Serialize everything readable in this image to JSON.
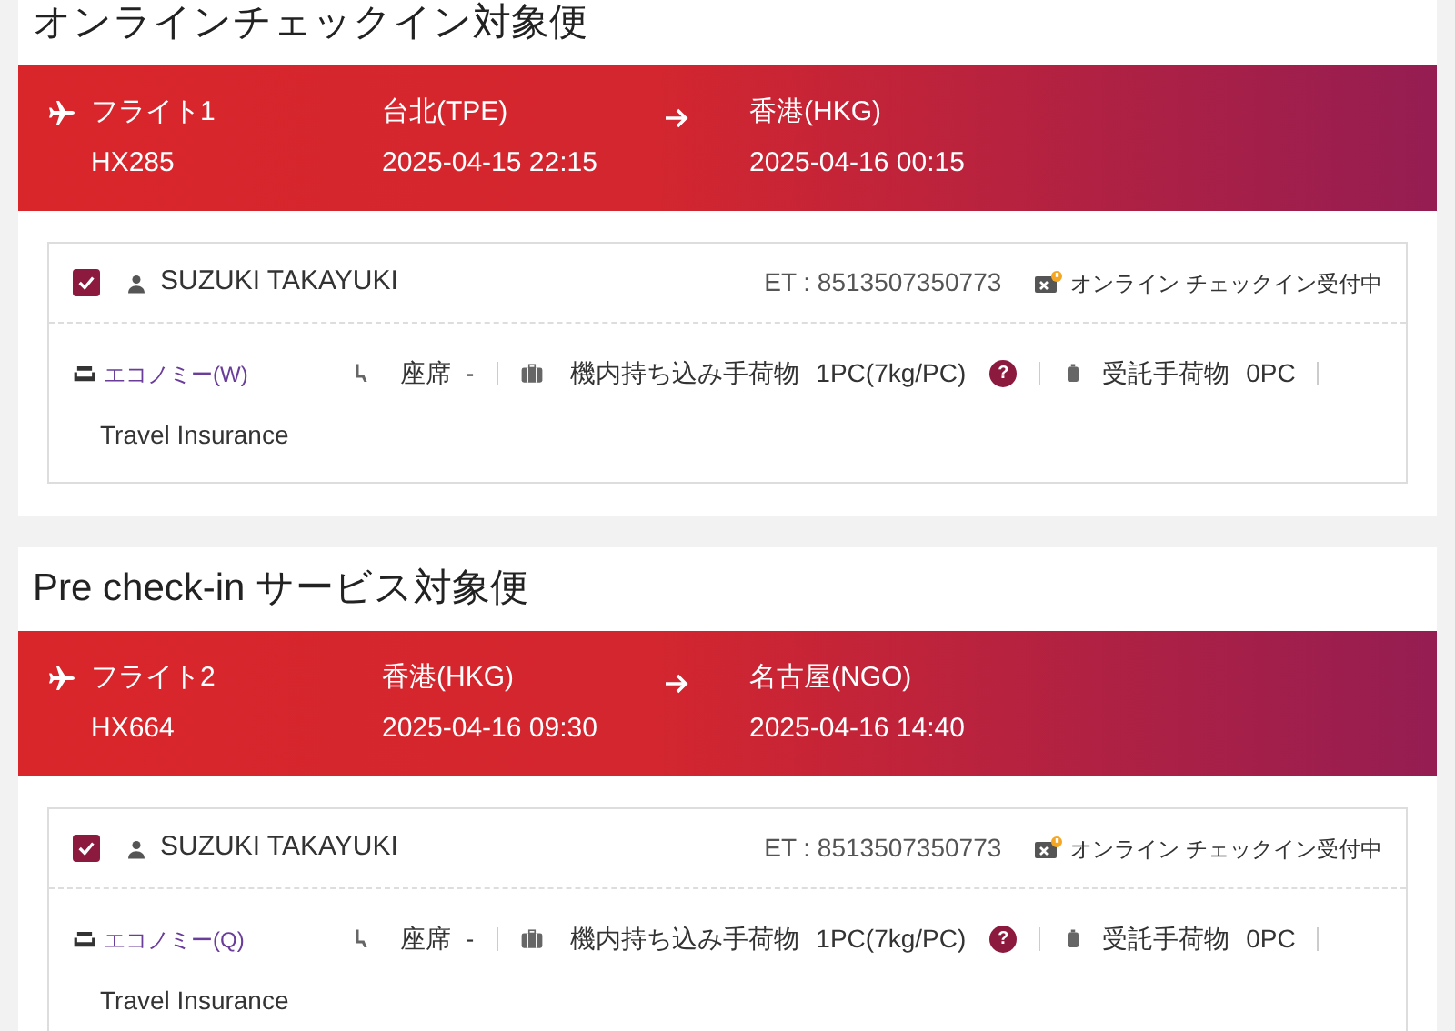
{
  "sections": [
    {
      "title": "オンラインチェックイン対象便",
      "flight": {
        "label": "フライト1",
        "number": "HX285",
        "from": "台北(TPE)",
        "depart": "2025-04-15 22:15",
        "to": "香港(HKG)",
        "arrive": "2025-04-16 00:15"
      },
      "passengers": [
        {
          "checked": true,
          "name": "SUZUKI TAKAYUKI",
          "et": "ET : 8513507350773",
          "status": "オンライン チェックイン受付中",
          "cabin": "エコノミー(W)",
          "seat_label": "座席",
          "seat_value": "-",
          "carry_label": "機内持ち込み手荷物",
          "carry_value": "1PC(7kg/PC)",
          "help": "?",
          "bag_label": "受託手荷物",
          "bag_value": "0PC",
          "insurance": "Travel Insurance"
        }
      ]
    },
    {
      "title": "Pre check-in サービス対象便",
      "flight": {
        "label": "フライト2",
        "number": "HX664",
        "from": "香港(HKG)",
        "depart": "2025-04-16 09:30",
        "to": "名古屋(NGO)",
        "arrive": "2025-04-16 14:40"
      },
      "passengers": [
        {
          "checked": true,
          "name": "SUZUKI TAKAYUKI",
          "et": "ET : 8513507350773",
          "status": "オンライン チェックイン受付中",
          "cabin": "エコノミー(Q)",
          "seat_label": "座席",
          "seat_value": "-",
          "carry_label": "機内持ち込み手荷物",
          "carry_value": "1PC(7kg/PC)",
          "help": "?",
          "bag_label": "受託手荷物",
          "bag_value": "0PC",
          "insurance": "Travel Insurance"
        }
      ]
    }
  ]
}
